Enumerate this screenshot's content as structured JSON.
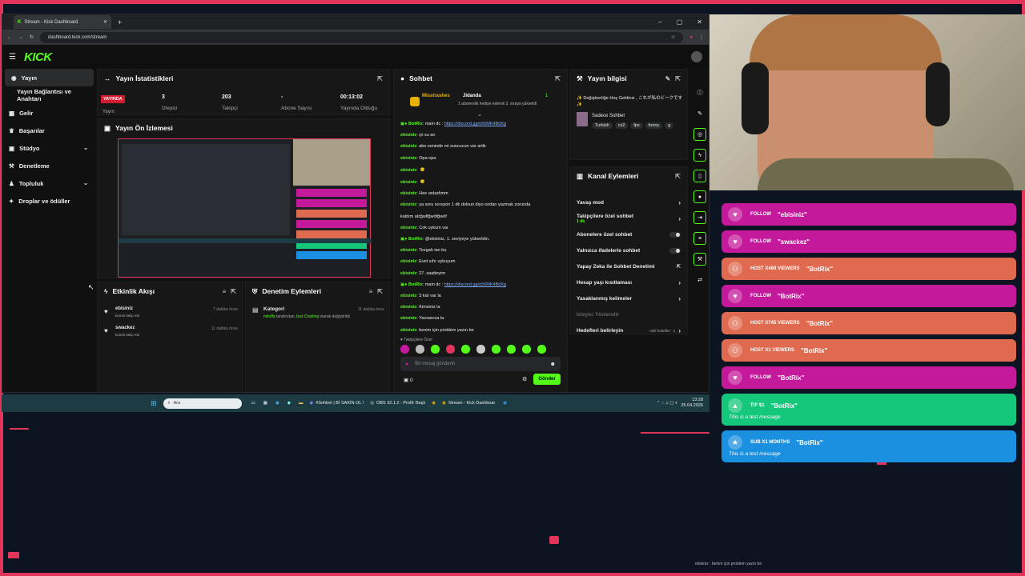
{
  "browser": {
    "tab_title": "Stream - Kick Dashboard",
    "url": "dashboard.kick.com/stream"
  },
  "brand": {
    "logo": "KICK",
    "accent": "#53fc18",
    "frame": "#e0345a"
  },
  "sidebar": {
    "items": [
      {
        "label": "Yayın",
        "icon": "broadcast-icon",
        "active": true
      },
      {
        "label": "Yayın Bağlantısı ve Anahtarı",
        "icon": ""
      },
      {
        "label": "Gelir",
        "icon": "wallet-icon"
      },
      {
        "label": "Başarılar",
        "icon": "trophy-icon"
      },
      {
        "label": "Stüdyo",
        "icon": "studio-icon",
        "chevron": "⌄"
      },
      {
        "label": "Denetleme",
        "icon": "wrench-icon"
      },
      {
        "label": "Topluluk",
        "icon": "community-icon",
        "chevron": "⌄"
      },
      {
        "label": "Droplar ve ödüller",
        "icon": "gift-icon"
      }
    ]
  },
  "stats": {
    "title": "Yayın İstatistikleri",
    "live_badge": "YAYINDA",
    "live_label": "Yayın",
    "items": [
      {
        "value": "3",
        "label": "İzleyici"
      },
      {
        "value": "203",
        "label": "Takipçi"
      },
      {
        "value": "-",
        "label": "Abone Sayısı"
      },
      {
        "value": "00:13:02",
        "label": "Yayında Olduğu"
      }
    ]
  },
  "preview": {
    "title": "Yayın Ön İzlemesi"
  },
  "activity": {
    "title": "Etkinlik Akışı",
    "items": [
      {
        "user": "ebisiniz",
        "sub": "kanalı takip etti",
        "time": "7 dakika önce"
      },
      {
        "user": "swackez",
        "sub": "kanalı takip etti",
        "time": "11 dakika önce"
      }
    ]
  },
  "modactions": {
    "title": "Denetim Eylemleri",
    "items": [
      {
        "label": "Kategori",
        "user": "miloffa",
        "mid": "tarafından",
        "cat": "Just Chatting",
        "end": "olarak değiştirildi",
        "time": "11 dakika önce"
      }
    ]
  },
  "chat": {
    "title": "Sohbet",
    "gift": {
      "user1": "Misstrashes",
      "user2": "Jidanda",
      "count": "1",
      "text": "1 aboneslik hediye ederek 3. sıraya yükseldi"
    },
    "lines": [
      {
        "user": "BotRix",
        "text": "main dc : ",
        "link": "https://discord.gg/o56MK4BdXg"
      },
      {
        "user": "ebisiniz",
        "text": "iyi su an"
      },
      {
        "user": "ebisiniz",
        "text": "abo seninde mi suncucun var artik"
      },
      {
        "user": "ebisiniz",
        "text": "Opa opa"
      },
      {
        "user": "ebisiniz",
        "text": ""
      },
      {
        "user": "ebisiniz",
        "text": ""
      },
      {
        "user": "ebisiniz",
        "text": "Hee anlazlimm"
      },
      {
        "user": "ebisiniz",
        "text": "ya soru soruyon 1 dk dolsun diyo ondan yazmak zorunda"
      },
      {
        "user": "",
        "text": "kaldım alzğwlfğwöfğwöf"
      },
      {
        "user": "ebisiniz",
        "text": "Cok uykum var"
      },
      {
        "user": "BotRix",
        "text": "@ebisiniz, 1. seviyeye yükseldin."
      },
      {
        "user": "ebisiniz",
        "text": "Tezgah ian bu"
      },
      {
        "user": "ebisiniz",
        "text": "Evet sıfır uykuyum"
      },
      {
        "user": "ebisiniz",
        "text": "27. saatteyim"
      },
      {
        "user": "BotRix",
        "text": "main dc : ",
        "link": "https://discord.gg/o56MK4BdXg"
      },
      {
        "user": "ebisiniz",
        "text": "3 kisi var la"
      },
      {
        "user": "ebisiniz",
        "text": "Kimsiniz la"
      },
      {
        "user": "ebisiniz",
        "text": "Yazsanıza la"
      },
      {
        "user": "ebisiniz",
        "text": "benim için problem yazın be"
      }
    ],
    "followers_only": "Takipçilere Özel",
    "placeholder": "Bir mesaj gönderin",
    "count": "0",
    "send": "Gönder"
  },
  "info": {
    "title": "Yayın bilgisi",
    "stream_title": "✨ Değişkenliğe Hoş Geldiniz , これが私のビークです ✨",
    "category": "Sadece Sohbet",
    "tags": [
      "Turkish",
      "cs2",
      "fps",
      "funny",
      "g"
    ]
  },
  "channel": {
    "title": "Kanal Eylemleri",
    "items": [
      {
        "label": "Yavaş mod",
        "right": "chevron"
      },
      {
        "label": "Takipçilere özel sohbet",
        "sub": "1 dk.",
        "right": "chevron"
      },
      {
        "label": "Abonelere özel sohbet",
        "right": "toggle"
      },
      {
        "label": "Yalnızca ifadelerle sohbet",
        "right": "toggle"
      },
      {
        "label": "Yapay Zeka ile Sohbet Denetimi",
        "right": "ext"
      },
      {
        "label": "Hesap yaşı kısıtlaması",
        "right": "chevron"
      },
      {
        "label": "Yasaklanmış kelimeler",
        "right": "chevron"
      },
      {
        "label": "İzleyici Yönlendir",
        "right": "none",
        "dim": true
      },
      {
        "label": "Hedefleri belirleyin",
        "right": "chevron",
        "extra": "Aktif hedefler : 1"
      }
    ]
  },
  "taskbar": {
    "search": "Ara",
    "apps": [
      "#Sohbet | Bİ SAKİN OL !",
      "OBS 32.1.2 - Profil: Başlı",
      "Stream - Kick Dashboar"
    ],
    "time": "13:28",
    "date": "25.04.2026"
  },
  "alerts": [
    {
      "type": "FOLLOW",
      "name": "\"ebisiniz\"",
      "color": "pink",
      "icon": "heart-icon"
    },
    {
      "type": "FOLLOW",
      "name": "\"swackez\"",
      "color": "pink",
      "icon": "heart-icon"
    },
    {
      "type": "HOST X489 VIEWERS",
      "name": "\"BotRix\"",
      "color": "salmon",
      "icon": "host-icon"
    },
    {
      "type": "FOLLOW",
      "name": "\"BotRix\"",
      "color": "pink",
      "icon": "heart-icon"
    },
    {
      "type": "HOST X745 VIEWERS",
      "name": "\"BotRix\"",
      "color": "salmon",
      "icon": "host-icon"
    },
    {
      "type": "HOST X1 VIEWERS",
      "name": "\"BotRix\"",
      "color": "salmon",
      "icon": "host-icon"
    },
    {
      "type": "FOLLOW",
      "name": "\"BotRix\"",
      "color": "pink",
      "icon": "heart-icon"
    },
    {
      "type": "TIP $1",
      "name": "\"BotRix\"",
      "color": "green",
      "icon": "tip-icon",
      "msg": "This is a test message"
    },
    {
      "type": "SUB X1 MONTHS",
      "name": "\"BotRix\"",
      "color": "blue",
      "icon": "star-icon",
      "msg": "This is a test message"
    }
  ],
  "ticker": "ebisiniz : benim için problem yazın be"
}
